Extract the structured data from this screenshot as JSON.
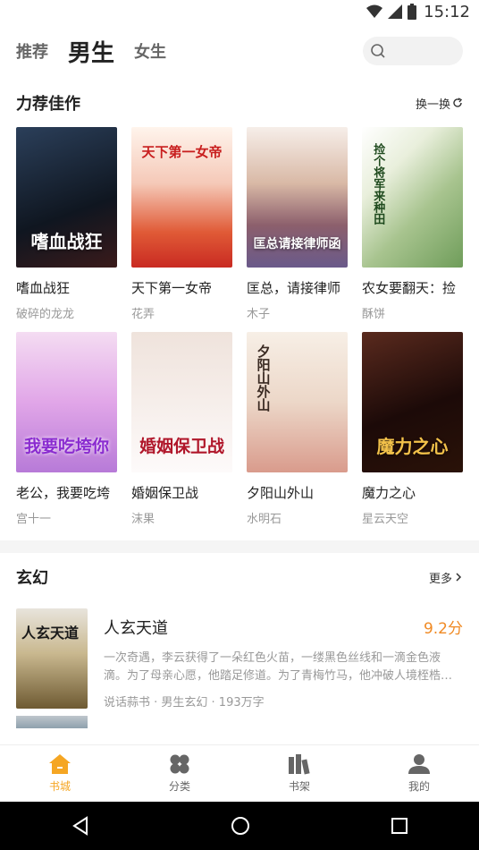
{
  "status": {
    "time": "15:12"
  },
  "header": {
    "tabs": [
      "推荐",
      "男生",
      "女生"
    ],
    "search_placeholder": ""
  },
  "recommend": {
    "title": "力荐佳作",
    "action": "换一换",
    "books": [
      {
        "title": "嗜血战狂",
        "author": "破碎的龙龙",
        "cover_text": "嗜血战狂",
        "cover_color": "#1d2a3a"
      },
      {
        "title": "天下第一女帝",
        "author": "花弄",
        "cover_text": "天下第一女帝",
        "cover_color": "#d9342b"
      },
      {
        "title": "匡总，请接律师",
        "author": "木子",
        "cover_text": "匡总请接律师函",
        "cover_color": "#c8a8b8"
      },
      {
        "title": "农女要翻天：捡",
        "author": "酥饼",
        "cover_text": "捡个将军来种田",
        "cover_color": "#9fb98a"
      },
      {
        "title": "老公，我要吃垮",
        "author": "宫十一",
        "cover_text": "我要吃垮你",
        "cover_color": "#d9a6e0"
      },
      {
        "title": "婚姻保卫战",
        "author": "沫果",
        "cover_text": "婚姻保卫战",
        "cover_color": "#f2e6e2"
      },
      {
        "title": "夕阳山外山",
        "author": "水明石",
        "cover_text": "夕阳山外山",
        "cover_color": "#efe4d6"
      },
      {
        "title": "魔力之心",
        "author": "星云天空",
        "cover_text": "魔力之心",
        "cover_color": "#3a1812"
      }
    ]
  },
  "xuanhuan": {
    "title": "玄幻",
    "action": "更多",
    "items": [
      {
        "title": "人玄天道",
        "score": "9.2分",
        "desc": "一次奇遇，李云获得了一朵红色火苗，一缕黑色丝线和一滴金色液滴。为了母亲心愿，他踏足修道。为了青梅竹马，他冲破人境桎梏…",
        "meta": "说话蒜书 · 男生玄幻 · 193万字",
        "cover_text": "人玄天道"
      }
    ],
    "peek": {
      "title": "",
      "score": ""
    }
  },
  "bottom_nav": [
    {
      "label": "书城",
      "icon": "home-icon"
    },
    {
      "label": "分类",
      "icon": "category-icon"
    },
    {
      "label": "书架",
      "icon": "bookshelf-icon"
    },
    {
      "label": "我的",
      "icon": "user-icon"
    }
  ],
  "colors": {
    "accent": "#f5a623",
    "score": "#f08a24"
  }
}
